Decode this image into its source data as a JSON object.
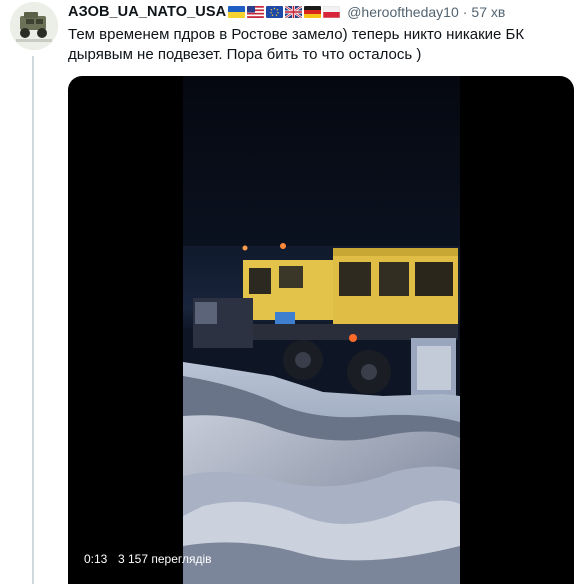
{
  "tweet": {
    "display_name": "АЗОВ_UA_NATO_USA",
    "flags": [
      "ukraine-flag-icon",
      "usa-flag-icon",
      "eu-flag-icon",
      "uk-flag-icon",
      "germany-flag-icon",
      "poland-flag-icon"
    ],
    "handle": "@herooftheday10",
    "separator": "·",
    "time": "57 хв",
    "text_lines": [
      "Тем временем пдров в Ростове замело) теперь никто никакие БК",
      "дырявым не подвезет. Пора бить то что осталось )"
    ]
  },
  "video": {
    "elapsed": "0:13",
    "views": "3 157 переглядів"
  },
  "colors": {
    "secondary_text": "#536471",
    "thread_line": "#cfd9de",
    "truck_yellow": "#e3c34a"
  }
}
